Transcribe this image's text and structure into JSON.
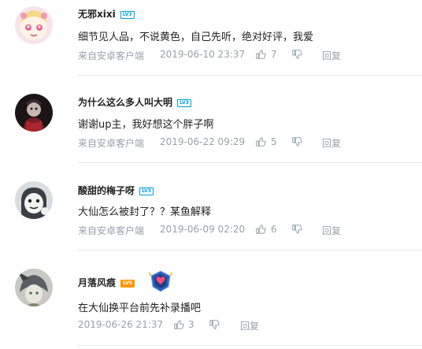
{
  "comments": [
    {
      "username": "无邪xixi",
      "level": "LV3",
      "text": "细节见人品，不说黄色，自己先听，绝对好评，我爱",
      "source": "来自安卓客户端",
      "date": "2019-06-10 23:37",
      "likes": "7",
      "reply": "回复"
    },
    {
      "username": "为什么这么多人叫大明",
      "level": "LV3",
      "text": "谢谢up主，我好想这个胖子啊",
      "source": "来自安卓客户端",
      "date": "2019-06-22 09:29",
      "likes": "5",
      "reply": "回复"
    },
    {
      "username": "酸甜的梅子呀",
      "level": "LV3",
      "text": "大仙怎么被封了？？某鱼解释",
      "source": "来自安卓客户端",
      "date": "2019-06-09 02:20",
      "likes": "6",
      "reply": "回复"
    },
    {
      "username": "月落风痕",
      "level": "LV5",
      "text": "在大仙换平台前先补录播吧",
      "date": "2019-06-26 21:37",
      "likes": "3",
      "reply": "回复"
    }
  ]
}
